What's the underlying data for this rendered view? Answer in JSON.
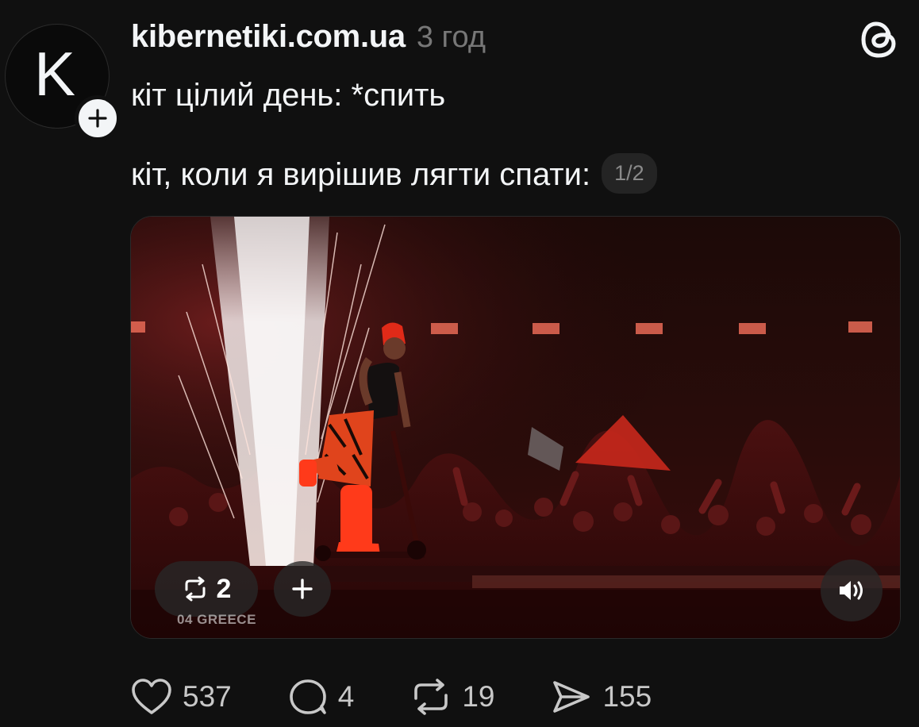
{
  "post": {
    "avatar_letter": "K",
    "username": "kibernetiki.com.ua",
    "timestamp": "3 год",
    "text_line_1": "кіт цілий день: *спить",
    "text_line_2": "кіт, коли я вирішив лягти спати:",
    "page_indicator": "1/2",
    "icons": [
      "plus-icon",
      "threads-logo-icon",
      "repost-icon",
      "volume-icon",
      "heart-icon",
      "comment-icon",
      "send-icon"
    ]
  },
  "media": {
    "caption": "04 GREECE",
    "repost_count": "2",
    "accent_color": "#e0301e"
  },
  "actions": {
    "likes": "537",
    "replies": "4",
    "reposts": "19",
    "shares": "155"
  }
}
